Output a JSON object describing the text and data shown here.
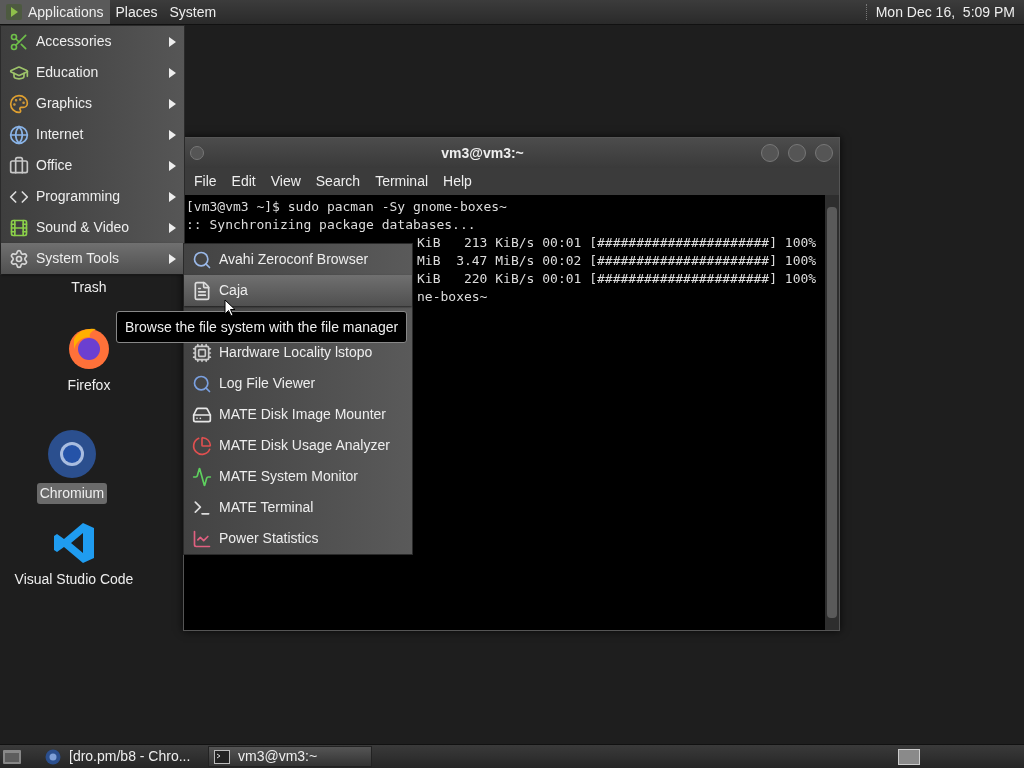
{
  "top_panel": {
    "menus": [
      {
        "label": "Applications",
        "selected": true
      },
      {
        "label": "Places",
        "selected": false
      },
      {
        "label": "System",
        "selected": false
      }
    ],
    "clock": "Mon Dec 16,  5:09 PM"
  },
  "applications_menu": {
    "items": [
      {
        "label": "Accessories",
        "selected": false
      },
      {
        "label": "Education",
        "selected": false
      },
      {
        "label": "Graphics",
        "selected": false
      },
      {
        "label": "Internet",
        "selected": false
      },
      {
        "label": "Office",
        "selected": false
      },
      {
        "label": "Programming",
        "selected": false
      },
      {
        "label": "Sound & Video",
        "selected": false
      },
      {
        "label": "System Tools",
        "selected": true
      }
    ]
  },
  "system_tools_menu": {
    "items": [
      {
        "label": "Avahi Zeroconf Browser",
        "selected": false
      },
      {
        "label": "Caja",
        "selected": true
      },
      {
        "label": "Hardware Locality lstopo",
        "selected": false
      },
      {
        "label": "Log File Viewer",
        "selected": false
      },
      {
        "label": "MATE Disk Image Mounter",
        "selected": false
      },
      {
        "label": "MATE Disk Usage Analyzer",
        "selected": false
      },
      {
        "label": "MATE System Monitor",
        "selected": false
      },
      {
        "label": "MATE Terminal",
        "selected": false
      },
      {
        "label": "Power Statistics",
        "selected": false
      }
    ]
  },
  "tooltip": "Browse the file system with the file manager",
  "desktop_icons": [
    {
      "label": "Trash",
      "selected": false
    },
    {
      "label": "Firefox",
      "selected": false
    },
    {
      "label": "Chromium",
      "selected": true
    },
    {
      "label": "Visual Studio Code",
      "selected": false
    }
  ],
  "terminal": {
    "title": "vm3@vm3:~",
    "menu": [
      "File",
      "Edit",
      "View",
      "Search",
      "Terminal",
      "Help"
    ],
    "lines": [
      {
        "text": "[vm3@vm3 ~]$ sudo pacman -Sy gnome-boxes~",
        "covered": false
      },
      {
        "text": ":: Synchronizing package databases...",
        "covered": false
      },
      {
        "text": "KiB   213 KiB/s 00:01 [######################] 100%",
        "covered": true
      },
      {
        "text": "MiB  3.47 MiB/s 00:02 [######################] 100%",
        "covered": true
      },
      {
        "text": "KiB   220 KiB/s 00:01 [######################] 100%",
        "covered": true
      },
      {
        "text": "ne-boxes~",
        "covered": true
      }
    ]
  },
  "taskbar": {
    "tasks": [
      {
        "label": "[dro.pm/b8 - Chro...",
        "selected": false
      },
      {
        "label": "vm3@vm3:~",
        "selected": true
      }
    ]
  }
}
